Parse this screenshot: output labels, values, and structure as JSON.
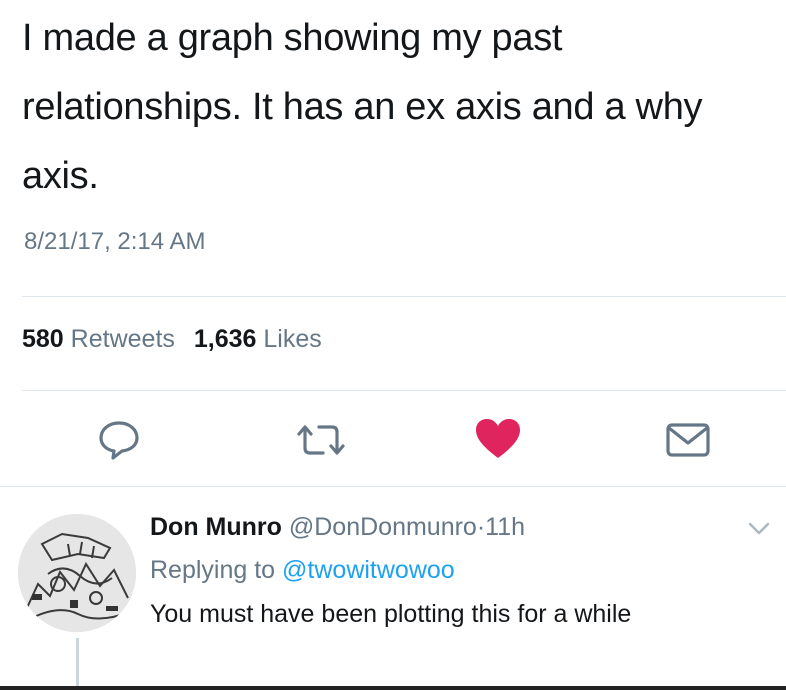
{
  "tweet": {
    "text": "I made a graph showing my past relationships. It has an ex axis and a why axis.",
    "timestamp": "8/21/17, 2:14 AM",
    "retweets_count": "580",
    "retweets_label": "Retweets",
    "likes_count": "1,636",
    "likes_label": "Likes"
  },
  "actions": {
    "reply_icon": "speech-bubble-icon",
    "retweet_icon": "retweet-arrows-icon",
    "like_icon": "heart-icon",
    "dm_icon": "envelope-icon",
    "like_color": "#e0245e",
    "icon_color": "#657786"
  },
  "reply": {
    "name": "Don Munro",
    "handle": "@DonDonmunro",
    "separator": "·",
    "time": "11h",
    "replying_prefix": "Replying to",
    "replying_to": "@twowitwowoo",
    "text": "You must have been plotting this for a while",
    "chevron_icon": "chevron-down-icon"
  },
  "colors": {
    "text": "#14171a",
    "muted": "#657786",
    "link": "#1da1f2",
    "divider": "#e1e8ed"
  }
}
